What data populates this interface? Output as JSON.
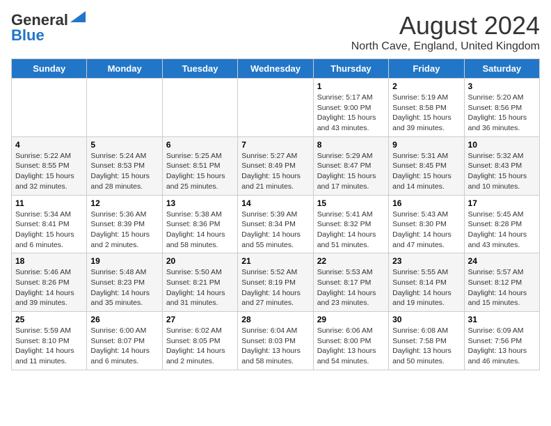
{
  "header": {
    "logo_general": "General",
    "logo_blue": "Blue",
    "title": "August 2024",
    "subtitle": "North Cave, England, United Kingdom"
  },
  "weekdays": [
    "Sunday",
    "Monday",
    "Tuesday",
    "Wednesday",
    "Thursday",
    "Friday",
    "Saturday"
  ],
  "weeks": [
    [
      {
        "day": "",
        "text": ""
      },
      {
        "day": "",
        "text": ""
      },
      {
        "day": "",
        "text": ""
      },
      {
        "day": "",
        "text": ""
      },
      {
        "day": "1",
        "text": "Sunrise: 5:17 AM\nSunset: 9:00 PM\nDaylight: 15 hours and 43 minutes."
      },
      {
        "day": "2",
        "text": "Sunrise: 5:19 AM\nSunset: 8:58 PM\nDaylight: 15 hours and 39 minutes."
      },
      {
        "day": "3",
        "text": "Sunrise: 5:20 AM\nSunset: 8:56 PM\nDaylight: 15 hours and 36 minutes."
      }
    ],
    [
      {
        "day": "4",
        "text": "Sunrise: 5:22 AM\nSunset: 8:55 PM\nDaylight: 15 hours and 32 minutes."
      },
      {
        "day": "5",
        "text": "Sunrise: 5:24 AM\nSunset: 8:53 PM\nDaylight: 15 hours and 28 minutes."
      },
      {
        "day": "6",
        "text": "Sunrise: 5:25 AM\nSunset: 8:51 PM\nDaylight: 15 hours and 25 minutes."
      },
      {
        "day": "7",
        "text": "Sunrise: 5:27 AM\nSunset: 8:49 PM\nDaylight: 15 hours and 21 minutes."
      },
      {
        "day": "8",
        "text": "Sunrise: 5:29 AM\nSunset: 8:47 PM\nDaylight: 15 hours and 17 minutes."
      },
      {
        "day": "9",
        "text": "Sunrise: 5:31 AM\nSunset: 8:45 PM\nDaylight: 15 hours and 14 minutes."
      },
      {
        "day": "10",
        "text": "Sunrise: 5:32 AM\nSunset: 8:43 PM\nDaylight: 15 hours and 10 minutes."
      }
    ],
    [
      {
        "day": "11",
        "text": "Sunrise: 5:34 AM\nSunset: 8:41 PM\nDaylight: 15 hours and 6 minutes."
      },
      {
        "day": "12",
        "text": "Sunrise: 5:36 AM\nSunset: 8:39 PM\nDaylight: 15 hours and 2 minutes."
      },
      {
        "day": "13",
        "text": "Sunrise: 5:38 AM\nSunset: 8:36 PM\nDaylight: 14 hours and 58 minutes."
      },
      {
        "day": "14",
        "text": "Sunrise: 5:39 AM\nSunset: 8:34 PM\nDaylight: 14 hours and 55 minutes."
      },
      {
        "day": "15",
        "text": "Sunrise: 5:41 AM\nSunset: 8:32 PM\nDaylight: 14 hours and 51 minutes."
      },
      {
        "day": "16",
        "text": "Sunrise: 5:43 AM\nSunset: 8:30 PM\nDaylight: 14 hours and 47 minutes."
      },
      {
        "day": "17",
        "text": "Sunrise: 5:45 AM\nSunset: 8:28 PM\nDaylight: 14 hours and 43 minutes."
      }
    ],
    [
      {
        "day": "18",
        "text": "Sunrise: 5:46 AM\nSunset: 8:26 PM\nDaylight: 14 hours and 39 minutes."
      },
      {
        "day": "19",
        "text": "Sunrise: 5:48 AM\nSunset: 8:23 PM\nDaylight: 14 hours and 35 minutes."
      },
      {
        "day": "20",
        "text": "Sunrise: 5:50 AM\nSunset: 8:21 PM\nDaylight: 14 hours and 31 minutes."
      },
      {
        "day": "21",
        "text": "Sunrise: 5:52 AM\nSunset: 8:19 PM\nDaylight: 14 hours and 27 minutes."
      },
      {
        "day": "22",
        "text": "Sunrise: 5:53 AM\nSunset: 8:17 PM\nDaylight: 14 hours and 23 minutes."
      },
      {
        "day": "23",
        "text": "Sunrise: 5:55 AM\nSunset: 8:14 PM\nDaylight: 14 hours and 19 minutes."
      },
      {
        "day": "24",
        "text": "Sunrise: 5:57 AM\nSunset: 8:12 PM\nDaylight: 14 hours and 15 minutes."
      }
    ],
    [
      {
        "day": "25",
        "text": "Sunrise: 5:59 AM\nSunset: 8:10 PM\nDaylight: 14 hours and 11 minutes."
      },
      {
        "day": "26",
        "text": "Sunrise: 6:00 AM\nSunset: 8:07 PM\nDaylight: 14 hours and 6 minutes."
      },
      {
        "day": "27",
        "text": "Sunrise: 6:02 AM\nSunset: 8:05 PM\nDaylight: 14 hours and 2 minutes."
      },
      {
        "day": "28",
        "text": "Sunrise: 6:04 AM\nSunset: 8:03 PM\nDaylight: 13 hours and 58 minutes."
      },
      {
        "day": "29",
        "text": "Sunrise: 6:06 AM\nSunset: 8:00 PM\nDaylight: 13 hours and 54 minutes."
      },
      {
        "day": "30",
        "text": "Sunrise: 6:08 AM\nSunset: 7:58 PM\nDaylight: 13 hours and 50 minutes."
      },
      {
        "day": "31",
        "text": "Sunrise: 6:09 AM\nSunset: 7:56 PM\nDaylight: 13 hours and 46 minutes."
      }
    ]
  ]
}
